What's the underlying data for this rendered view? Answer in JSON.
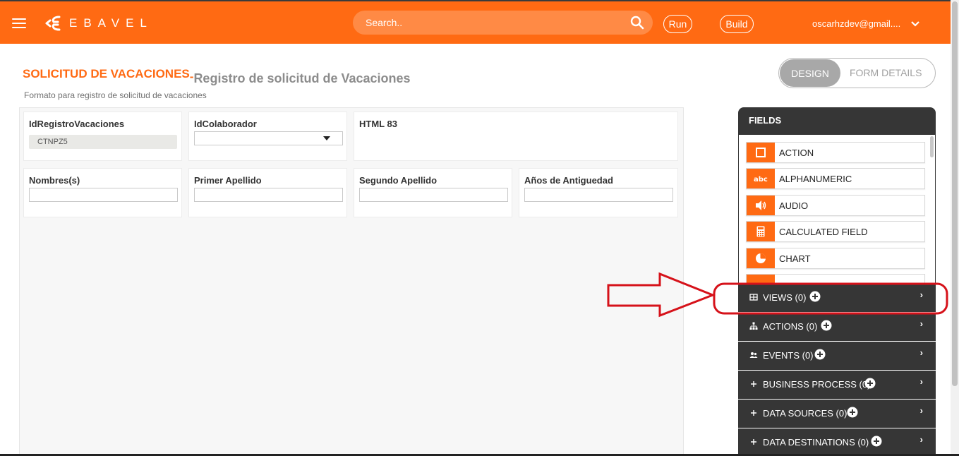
{
  "header": {
    "logo_text": "EBAVEL",
    "search_placeholder": "Search..",
    "run_label": "Run",
    "build_label": "Build",
    "user_email": "oscarhzdev@gmail...."
  },
  "form": {
    "title": "SOLICITUD DE VACACIONES",
    "dash": "-",
    "subtitle_main": "Registro de solicitud de Vacaciones",
    "description": "Formato para registro de solicitud de vacaciones"
  },
  "toggle": {
    "design_label": "DESIGN",
    "details_label": "FORM DETAILS"
  },
  "cards": {
    "id_registro": {
      "label": "IdRegistroVacaciones",
      "value": "CTNPZ5"
    },
    "id_colaborador": {
      "label": "IdColaborador"
    },
    "html83": {
      "label": "HTML 83"
    },
    "nombres": {
      "label": "Nombres(s)"
    },
    "primer_apellido": {
      "label": "Primer Apellido"
    },
    "segundo_apellido": {
      "label": "Segundo Apellido"
    },
    "anios": {
      "label": "Años de Antiguedad"
    }
  },
  "panel": {
    "title": "FIELDS",
    "fields": [
      {
        "label": "ACTION",
        "icon": "square-outline-icon"
      },
      {
        "label": "ALPHANUMERIC",
        "icon": "abc-icon"
      },
      {
        "label": "AUDIO",
        "icon": "speaker-icon"
      },
      {
        "label": "CALCULATED FIELD",
        "icon": "calculator-icon"
      },
      {
        "label": "CHART",
        "icon": "pie-chart-icon"
      }
    ],
    "sections": [
      {
        "label": "VIEWS (0)",
        "icon": "table-icon"
      },
      {
        "label": "ACTIONS (0)",
        "icon": "hierarchy-icon"
      },
      {
        "label": "EVENTS (0)",
        "icon": "people-icon"
      },
      {
        "label": "BUSINESS PROCESS (0)",
        "icon": "plus-icon"
      },
      {
        "label": "DATA SOURCES (0)",
        "icon": "plus-icon"
      },
      {
        "label": "DATA DESTINATIONS (0)",
        "icon": "plus-icon"
      }
    ]
  },
  "colors": {
    "brand_orange": "#ff6a13",
    "panel_dark": "#363636",
    "annotation_red": "#d6121a"
  }
}
